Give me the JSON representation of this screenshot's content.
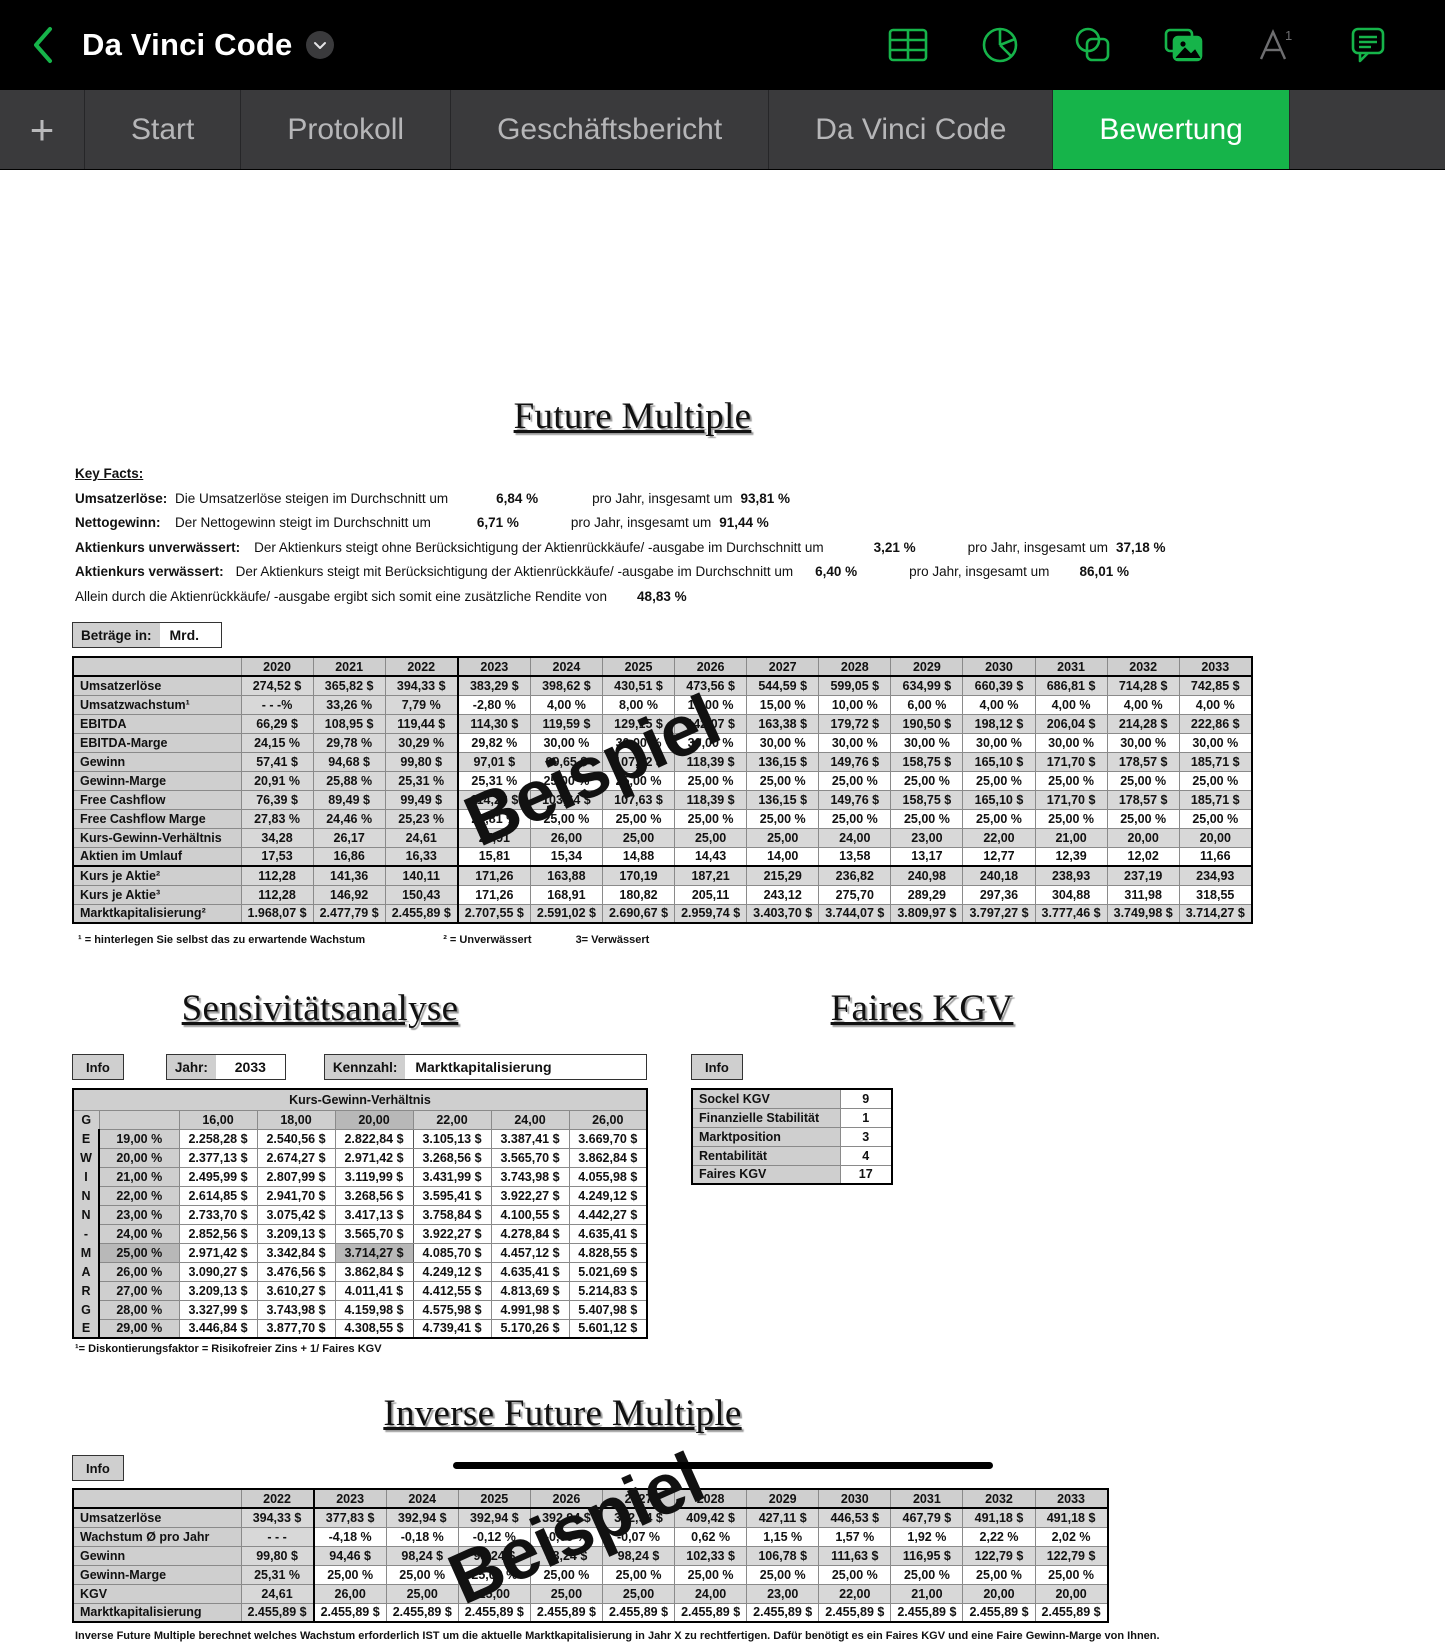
{
  "titlebar": {
    "document_title": "Da Vinci Code",
    "back_icon": "back-chevron-icon",
    "caret_icon": "chevron-down-icon",
    "icons": [
      {
        "name": "table-icon",
        "label": "Tabelle"
      },
      {
        "name": "chart-icon",
        "label": "Diagramm"
      },
      {
        "name": "shapes-icon",
        "label": "Form"
      },
      {
        "name": "media-icon",
        "label": "Medien"
      },
      {
        "name": "text-format-icon",
        "label": "A¹"
      },
      {
        "name": "comment-icon",
        "label": "Kommentar"
      }
    ],
    "accent_color": "#16b44a"
  },
  "tabbar": {
    "add_label": "+",
    "tabs": [
      {
        "label": "Start",
        "active": false
      },
      {
        "label": "Protokoll",
        "active": false
      },
      {
        "label": "Geschäftsbericht",
        "active": false
      },
      {
        "label": "Da Vinci Code",
        "active": false
      },
      {
        "label": "Bewertung",
        "active": true
      }
    ]
  },
  "watermark_text": "Beispiel",
  "future_multiple": {
    "title": "Future Multiple",
    "key_facts_heading": "Key Facts:",
    "key_facts": [
      {
        "label": "Umsatzerlöse:",
        "text": "Die Umsatzerlöse steigen im Durchschnitt um",
        "value1": "6,84 %",
        "text2": "pro Jahr, insgesamt um",
        "value2": "93,81 %"
      },
      {
        "label": "Nettogewinn:",
        "text": "Der Nettogewinn steigt im Durchschnitt um",
        "value1": "6,71 %",
        "text2": "pro Jahr, insgesamt um",
        "value2": "91,44 %"
      },
      {
        "label": "Aktienkurs unverwässert:",
        "text": "Der Aktienkurs steigt ohne Berücksichtigung der Aktienrückkäufe/ -ausgabe im Durchschnitt um",
        "value1": "3,21 %",
        "text2": "pro Jahr, insgesamt um",
        "value2": "37,18 %"
      },
      {
        "label": "Aktienkurs verwässert:",
        "text": "Der Aktienkurs steigt mit Berücksichtigung der Aktienrückkäufe/ -ausgabe im Durchschnitt um",
        "value1": "6,40 %",
        "text2": "pro Jahr, insgesamt um",
        "value2": "86,01 %"
      },
      {
        "label": "",
        "text": "Allein durch die Aktienrückkäufe/ -ausgabe ergibt sich somit eine zusätzliche Rendite von",
        "value1": "48,83 %",
        "text2": "",
        "value2": ""
      }
    ],
    "units_label": "Beträge in:",
    "units_value": "Mrd.",
    "footnotes": [
      "¹ = hinterlegen Sie selbst das zu erwartende Wachstum",
      "² = Unverwässert",
      "3= Verwässert"
    ],
    "table": {
      "years": [
        "2020",
        "2021",
        "2022",
        "2023",
        "2024",
        "2025",
        "2026",
        "2027",
        "2028",
        "2029",
        "2030",
        "2031",
        "2032",
        "2033"
      ],
      "rows": [
        {
          "label": "Umsatzerlöse",
          "values": [
            "274,52 $",
            "365,82 $",
            "394,33 $",
            "383,29 $",
            "398,62 $",
            "430,51 $",
            "473,56 $",
            "544,59 $",
            "599,05 $",
            "634,99 $",
            "660,39 $",
            "686,81 $",
            "714,28 $",
            "742,85 $"
          ]
        },
        {
          "label": "Umsatzwachstum¹",
          "values": [
            "- - -%",
            "33,26 %",
            "7,79 %",
            "-2,80 %",
            "4,00 %",
            "8,00 %",
            "10,00 %",
            "15,00 %",
            "10,00 %",
            "6,00 %",
            "4,00 %",
            "4,00 %",
            "4,00 %",
            "4,00 %"
          ]
        },
        {
          "label": "EBITDA",
          "values": [
            "66,29 $",
            "108,95 $",
            "119,44 $",
            "114,30 $",
            "119,59 $",
            "129,15 $",
            "142,07 $",
            "163,38 $",
            "179,72 $",
            "190,50 $",
            "198,12 $",
            "206,04 $",
            "214,28 $",
            "222,86 $"
          ]
        },
        {
          "label": "EBITDA-Marge",
          "values": [
            "24,15 %",
            "29,78 %",
            "30,29 %",
            "29,82 %",
            "30,00 %",
            "30,00 %",
            "30,00 %",
            "30,00 %",
            "30,00 %",
            "30,00 %",
            "30,00 %",
            "30,00 %",
            "30,00 %",
            "30,00 %"
          ]
        },
        {
          "label": "Gewinn",
          "values": [
            "57,41 $",
            "94,68 $",
            "99,80 $",
            "97,01 $",
            "99,65 $",
            "107,62 $",
            "118,39 $",
            "136,15 $",
            "149,76 $",
            "158,75 $",
            "165,10 $",
            "171,70 $",
            "178,57 $",
            "185,71 $"
          ]
        },
        {
          "label": "Gewinn-Marge",
          "values": [
            "20,91 %",
            "25,88 %",
            "25,31 %",
            "25,31 %",
            "25,00 %",
            "25,00 %",
            "25,00 %",
            "25,00 %",
            "25,00 %",
            "25,00 %",
            "25,00 %",
            "25,00 %",
            "25,00 %",
            "25,00 %"
          ]
        },
        {
          "label": "Free Cashflow",
          "values": [
            "76,39 $",
            "89,49 $",
            "99,49 $",
            "114,26 $",
            "103,64 $",
            "107,63 $",
            "118,39 $",
            "136,15 $",
            "149,76 $",
            "158,75 $",
            "165,10 $",
            "171,70 $",
            "178,57 $",
            "185,71 $"
          ]
        },
        {
          "label": "Free Cashflow Marge",
          "values": [
            "27,83 %",
            "24,46 %",
            "25,23 %",
            "29,81 %",
            "25,00 %",
            "25,00 %",
            "25,00 %",
            "25,00 %",
            "25,00 %",
            "25,00 %",
            "25,00 %",
            "25,00 %",
            "25,00 %",
            "25,00 %"
          ]
        },
        {
          "label": "Kurs-Gewinn-Verhältnis",
          "values": [
            "34,28",
            "26,17",
            "24,61",
            "27,91",
            "26,00",
            "25,00",
            "25,00",
            "25,00",
            "24,00",
            "23,00",
            "22,00",
            "21,00",
            "20,00",
            "20,00"
          ]
        },
        {
          "label": "Aktien im Umlauf",
          "values": [
            "17,53",
            "16,86",
            "16,33",
            "15,81",
            "15,34",
            "14,88",
            "14,43",
            "14,00",
            "13,58",
            "13,17",
            "12,77",
            "12,39",
            "12,02",
            "11,66"
          ]
        },
        {
          "label": "Kurs je Aktie²",
          "values": [
            "112,28",
            "141,36",
            "140,11",
            "171,26",
            "163,88",
            "170,19",
            "187,21",
            "215,29",
            "236,82",
            "240,98",
            "240,18",
            "238,93",
            "237,19",
            "234,93"
          ]
        },
        {
          "label": "Kurs je Aktie³",
          "values": [
            "112,28",
            "146,92",
            "150,43",
            "171,26",
            "168,91",
            "180,82",
            "205,11",
            "243,12",
            "275,70",
            "289,29",
            "297,36",
            "304,88",
            "311,98",
            "318,55"
          ]
        },
        {
          "label": "Marktkapitalisierung²",
          "values": [
            "1.968,07 $",
            "2.477,79 $",
            "2.455,89 $",
            "2.707,55 $",
            "2.591,02 $",
            "2.690,67 $",
            "2.959,74 $",
            "3.403,70 $",
            "3.744,07 $",
            "3.809,97 $",
            "3.797,27 $",
            "3.777,46 $",
            "3.749,98 $",
            "3.714,27 $"
          ]
        }
      ]
    }
  },
  "sensitivity": {
    "title": "Sensivitätsanalyse",
    "info_label": "Info",
    "year_label": "Jahr:",
    "year_value": "2033",
    "metric_label": "Kennzahl:",
    "metric_value": "Marktkapitalisierung",
    "matrix_title": "Kurs-Gewinn-Verhältnis",
    "side_letters": [
      "G",
      "E",
      "W",
      "I",
      "N",
      "N",
      "-",
      "M",
      "A",
      "R",
      "G",
      "E"
    ],
    "col_headers": [
      "16,00",
      "18,00",
      "20,00",
      "22,00",
      "24,00",
      "26,00"
    ],
    "highlight_col_index": 2,
    "highlight_row_index": 6,
    "rows": [
      {
        "margin": "19,00 %",
        "values": [
          "2.258,28 $",
          "2.540,56 $",
          "2.822,84 $",
          "3.105,13 $",
          "3.387,41 $",
          "3.669,70 $"
        ]
      },
      {
        "margin": "20,00 %",
        "values": [
          "2.377,13 $",
          "2.674,27 $",
          "2.971,42 $",
          "3.268,56 $",
          "3.565,70 $",
          "3.862,84 $"
        ]
      },
      {
        "margin": "21,00 %",
        "values": [
          "2.495,99 $",
          "2.807,99 $",
          "3.119,99 $",
          "3.431,99 $",
          "3.743,98 $",
          "4.055,98 $"
        ]
      },
      {
        "margin": "22,00 %",
        "values": [
          "2.614,85 $",
          "2.941,70 $",
          "3.268,56 $",
          "3.595,41 $",
          "3.922,27 $",
          "4.249,12 $"
        ]
      },
      {
        "margin": "23,00 %",
        "values": [
          "2.733,70 $",
          "3.075,42 $",
          "3.417,13 $",
          "3.758,84 $",
          "4.100,55 $",
          "4.442,27 $"
        ]
      },
      {
        "margin": "24,00 %",
        "values": [
          "2.852,56 $",
          "3.209,13 $",
          "3.565,70 $",
          "3.922,27 $",
          "4.278,84 $",
          "4.635,41 $"
        ]
      },
      {
        "margin": "25,00 %",
        "values": [
          "2.971,42 $",
          "3.342,84 $",
          "3.714,27 $",
          "4.085,70 $",
          "4.457,12 $",
          "4.828,55 $"
        ]
      },
      {
        "margin": "26,00 %",
        "values": [
          "3.090,27 $",
          "3.476,56 $",
          "3.862,84 $",
          "4.249,12 $",
          "4.635,41 $",
          "5.021,69 $"
        ]
      },
      {
        "margin": "27,00 %",
        "values": [
          "3.209,13 $",
          "3.610,27 $",
          "4.011,41 $",
          "4.412,55 $",
          "4.813,69 $",
          "5.214,83 $"
        ]
      },
      {
        "margin": "28,00 %",
        "values": [
          "3.327,99 $",
          "3.743,98 $",
          "4.159,98 $",
          "4.575,98 $",
          "4.991,98 $",
          "5.407,98 $"
        ]
      },
      {
        "margin": "29,00 %",
        "values": [
          "3.446,84 $",
          "3.877,70 $",
          "4.308,55 $",
          "4.739,41 $",
          "5.170,26 $",
          "5.601,12 $"
        ]
      }
    ],
    "footnote": "¹= Diskontierungsfaktor = Risikofreier Zins + 1/ Faires KGV"
  },
  "faires_kgv": {
    "title": "Faires KGV",
    "info_label": "Info",
    "rows": [
      {
        "label": "Sockel KGV",
        "value": "9"
      },
      {
        "label": "Finanzielle Stabilität",
        "value": "1"
      },
      {
        "label": "Marktposition",
        "value": "3"
      },
      {
        "label": "Rentabilität",
        "value": "4"
      },
      {
        "label": "Faires KGV",
        "value": "17"
      }
    ]
  },
  "inverse": {
    "title": "Inverse Future Multiple",
    "info_label": "Info",
    "years": [
      "2022",
      "2023",
      "2024",
      "2025",
      "2026",
      "2027",
      "2028",
      "2029",
      "2030",
      "2031",
      "2032",
      "2033"
    ],
    "rows": [
      {
        "label": "Umsatzerlöse",
        "values": [
          "394,33 $",
          "377,83 $",
          "392,94 $",
          "392,94 $",
          "392,94 $",
          "392,94 $",
          "409,42 $",
          "427,11 $",
          "446,53 $",
          "467,79 $",
          "491,18 $",
          "491,18 $"
        ]
      },
      {
        "label": "Wachstum Ø pro Jahr",
        "values": [
          "- - -",
          "-4,18 %",
          "-0,18 %",
          "-0,12 %",
          "-0,09 %",
          "-0,07 %",
          "0,62 %",
          "1,15 %",
          "1,57 %",
          "1,92 %",
          "2,22 %",
          "2,02 %"
        ]
      },
      {
        "label": "Gewinn",
        "values": [
          "99,80 $",
          "94,46 $",
          "98,24 $",
          "98,24 $",
          "98,24 $",
          "98,24 $",
          "102,33 $",
          "106,78 $",
          "111,63 $",
          "116,95 $",
          "122,79 $",
          "122,79 $"
        ]
      },
      {
        "label": "Gewinn-Marge",
        "values": [
          "25,31 %",
          "25,00 %",
          "25,00 %",
          "25,00 %",
          "25,00 %",
          "25,00 %",
          "25,00 %",
          "25,00 %",
          "25,00 %",
          "25,00 %",
          "25,00 %",
          "25,00 %"
        ]
      },
      {
        "label": "KGV",
        "values": [
          "24,61",
          "26,00",
          "25,00",
          "25,00",
          "25,00",
          "25,00",
          "24,00",
          "23,00",
          "22,00",
          "21,00",
          "20,00",
          "20,00"
        ]
      },
      {
        "label": "Marktkapitalisierung",
        "values": [
          "2.455,89 $",
          "2.455,89 $",
          "2.455,89 $",
          "2.455,89 $",
          "2.455,89 $",
          "2.455,89 $",
          "2.455,89 $",
          "2.455,89 $",
          "2.455,89 $",
          "2.455,89 $",
          "2.455,89 $",
          "2.455,89 $"
        ]
      }
    ],
    "footnote": "Inverse Future Multiple berechnet welches Wachstum erforderlich IST um die aktuelle Marktkapitalisierung in Jahr X zu rechtfertigen. Dafür benötigt es ein Faires KGV und eine Faire Gewinn-Marge von Ihnen."
  }
}
